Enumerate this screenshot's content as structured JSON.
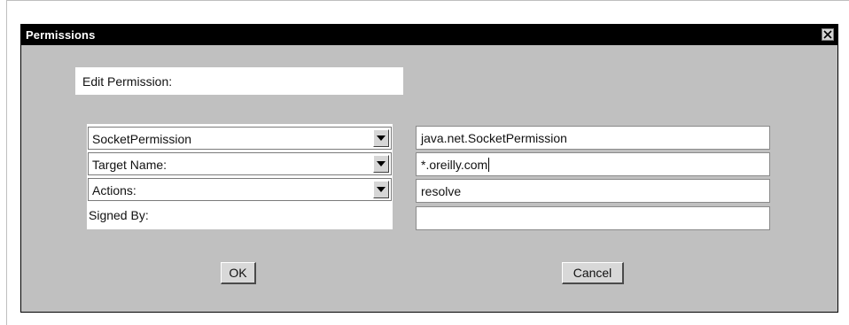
{
  "window": {
    "title": "Permissions",
    "close_icon": "close-icon"
  },
  "editor": {
    "heading": "Edit Permission:",
    "combos": [
      {
        "value": "SocketPermission"
      },
      {
        "value": "Target Name:"
      },
      {
        "value": "Actions:"
      }
    ],
    "signed_by_label": "Signed By:",
    "fields": [
      {
        "value": "java.net.SocketPermission"
      },
      {
        "value": "*.oreilly.com"
      },
      {
        "value": "resolve"
      },
      {
        "value": ""
      }
    ]
  },
  "buttons": {
    "ok_label": "OK",
    "cancel_label": "Cancel"
  },
  "colors": {
    "window_bg": "#c0c0c0",
    "titlebar_bg": "#000000",
    "titlebar_text": "#ffffff",
    "field_bg": "#ffffff"
  }
}
